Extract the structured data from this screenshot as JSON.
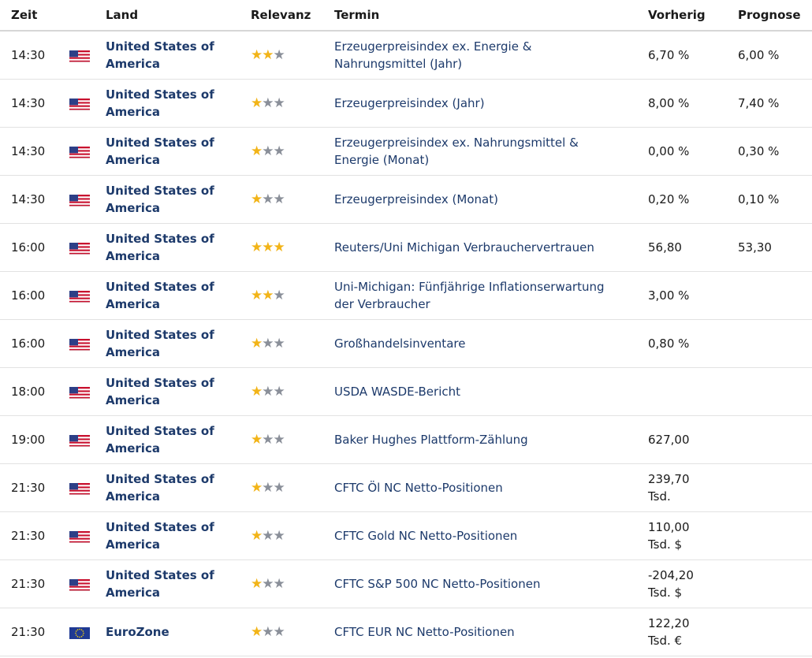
{
  "headers": {
    "zeit": "Zeit",
    "land": "Land",
    "relevanz": "Relevanz",
    "termin": "Termin",
    "vorherig": "Vorherig",
    "prognose": "Prognose"
  },
  "colors": {
    "star_active": "#f2b418",
    "star_inactive": "#8a8f99",
    "link": "#1d3a6b"
  },
  "rows": [
    {
      "zeit": "14:30",
      "flag": "us-flag-icon",
      "land": "United States of America",
      "relevanz": 2,
      "termin": "Erzeugerpreisindex ex. Energie & Nahrungsmittel (Jahr)",
      "vorherig": "6,70 %",
      "prognose": "6,00 %"
    },
    {
      "zeit": "14:30",
      "flag": "us-flag-icon",
      "land": "United States of America",
      "relevanz": 1,
      "termin": "Erzeugerpreisindex (Jahr)",
      "vorherig": "8,00 %",
      "prognose": "7,40 %"
    },
    {
      "zeit": "14:30",
      "flag": "us-flag-icon",
      "land": "United States of America",
      "relevanz": 1,
      "termin": "Erzeugerpreisindex ex. Nahrungsmittel & Energie (Monat)",
      "vorherig": "0,00 %",
      "prognose": "0,30 %"
    },
    {
      "zeit": "14:30",
      "flag": "us-flag-icon",
      "land": "United States of America",
      "relevanz": 1,
      "termin": "Erzeugerpreisindex (Monat)",
      "vorherig": "0,20 %",
      "prognose": "0,10 %"
    },
    {
      "zeit": "16:00",
      "flag": "us-flag-icon",
      "land": "United States of America",
      "relevanz": 3,
      "termin": "Reuters/Uni Michigan Verbrauchervertrauen",
      "vorherig": "56,80",
      "prognose": "53,30"
    },
    {
      "zeit": "16:00",
      "flag": "us-flag-icon",
      "land": "United States of America",
      "relevanz": 2,
      "termin": "Uni-Michigan: Fünfjährige Inflationserwartung der Verbraucher",
      "vorherig": "3,00 %",
      "prognose": ""
    },
    {
      "zeit": "16:00",
      "flag": "us-flag-icon",
      "land": "United States of America",
      "relevanz": 1,
      "termin": "Großhandelsinventare",
      "vorherig": "0,80 %",
      "prognose": ""
    },
    {
      "zeit": "18:00",
      "flag": "us-flag-icon",
      "land": "United States of America",
      "relevanz": 1,
      "termin": "USDA WASDE-Bericht",
      "vorherig": "",
      "prognose": ""
    },
    {
      "zeit": "19:00",
      "flag": "us-flag-icon",
      "land": "United States of America",
      "relevanz": 1,
      "termin": "Baker Hughes Plattform-Zählung",
      "vorherig": "627,00",
      "prognose": ""
    },
    {
      "zeit": "21:30",
      "flag": "us-flag-icon",
      "land": "United States of America",
      "relevanz": 1,
      "termin": "CFTC Öl NC Netto-Positionen",
      "vorherig": "239,70 Tsd.",
      "prognose": ""
    },
    {
      "zeit": "21:30",
      "flag": "us-flag-icon",
      "land": "United States of America",
      "relevanz": 1,
      "termin": "CFTC Gold NC Netto-Positionen",
      "vorherig": "110,00 Tsd. $",
      "prognose": ""
    },
    {
      "zeit": "21:30",
      "flag": "us-flag-icon",
      "land": "United States of America",
      "relevanz": 1,
      "termin": "CFTC S&P 500 NC Netto-Positionen",
      "vorherig": "-204,20 Tsd. $",
      "prognose": ""
    },
    {
      "zeit": "21:30",
      "flag": "eu-flag-icon",
      "land": "EuroZone",
      "relevanz": 1,
      "termin": "CFTC EUR NC Netto-Positionen",
      "vorherig": "122,20 Tsd. €",
      "prognose": ""
    }
  ]
}
